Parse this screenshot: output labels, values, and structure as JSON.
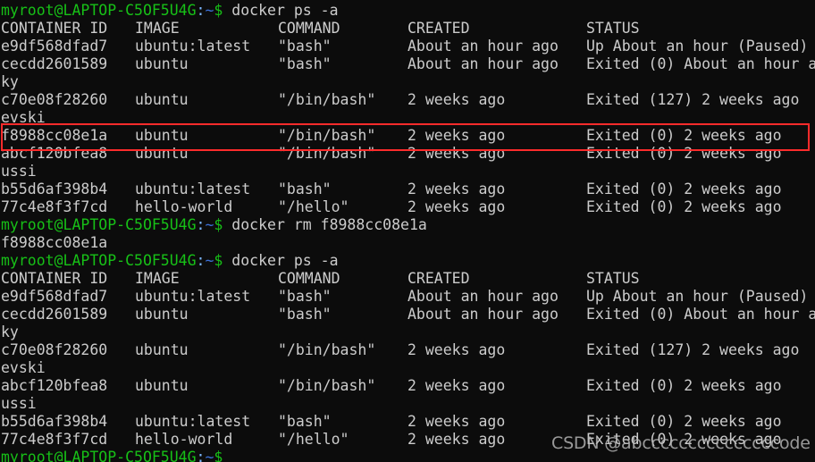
{
  "terminal": {
    "prompt": {
      "user_host": "myroot@LAPTOP-C5OF5U4G",
      "colon": ":",
      "tilde": "~",
      "dollar": "$",
      "colors": {
        "user_host": "#17c017",
        "colon": "#7cb7ff",
        "tilde": "#3b6fd6",
        "dollar": "#17c017",
        "text": "#cccccc",
        "background": "#0c0c0c",
        "highlight": "#ff2b2b"
      }
    },
    "commands": {
      "ps_a": "docker ps -a",
      "rm": "docker rm f8988cc08e1a"
    },
    "rm_output": "f8988cc08e1a",
    "table_headers": {
      "container_id": "CONTAINER ID",
      "image": "IMAGE",
      "command": "COMMAND",
      "created": "CREATED",
      "status": "STATUS"
    },
    "table_one": [
      {
        "id": "e9df568dfad7",
        "image": "ubuntu:latest",
        "command": "\"bash\"",
        "created": "About an hour ago",
        "status": "Up About an hour (Paused)",
        "wrap": ""
      },
      {
        "id": "cecdd2601589",
        "image": "ubuntu",
        "command": "\"bash\"",
        "created": "About an hour ago",
        "status": "Exited (0) About an hour a",
        "wrap": "ky"
      },
      {
        "id": "c70e08f28260",
        "image": "ubuntu",
        "command": "\"/bin/bash\"",
        "created": "2 weeks ago",
        "status": "Exited (127) 2 weeks ago",
        "wrap": "evski"
      },
      {
        "id": "f8988cc08e1a",
        "image": "ubuntu",
        "command": "\"/bin/bash\"",
        "created": "2 weeks ago",
        "status": "Exited (0) 2 weeks ago",
        "wrap": ""
      },
      {
        "id": "abcf120bfea8",
        "image": "ubuntu",
        "command": "\"/bin/bash\"",
        "created": "2 weeks ago",
        "status": "Exited (0) 2 weeks ago",
        "wrap": "ussi"
      },
      {
        "id": "b55d6af398b4",
        "image": "ubuntu:latest",
        "command": "\"bash\"",
        "created": "2 weeks ago",
        "status": "Exited (0) 2 weeks ago",
        "wrap": ""
      },
      {
        "id": "77c4e8f3f7cd",
        "image": "hello-world",
        "command": "\"/hello\"",
        "created": "2 weeks ago",
        "status": "Exited (0) 2 weeks ago",
        "wrap": ""
      }
    ],
    "table_two": [
      {
        "id": "e9df568dfad7",
        "image": "ubuntu:latest",
        "command": "\"bash\"",
        "created": "About an hour ago",
        "status": "Up About an hour (Paused)",
        "wrap": ""
      },
      {
        "id": "cecdd2601589",
        "image": "ubuntu",
        "command": "\"bash\"",
        "created": "About an hour ago",
        "status": "Exited (0) About an hour a",
        "wrap": "ky"
      },
      {
        "id": "c70e08f28260",
        "image": "ubuntu",
        "command": "\"/bin/bash\"",
        "created": "2 weeks ago",
        "status": "Exited (127) 2 weeks ago",
        "wrap": "evski"
      },
      {
        "id": "abcf120bfea8",
        "image": "ubuntu",
        "command": "\"/bin/bash\"",
        "created": "2 weeks ago",
        "status": "Exited (0) 2 weeks ago",
        "wrap": "ussi"
      },
      {
        "id": "b55d6af398b4",
        "image": "ubuntu:latest",
        "command": "\"bash\"",
        "created": "2 weeks ago",
        "status": "Exited (0) 2 weeks ago",
        "wrap": ""
      },
      {
        "id": "77c4e8f3f7cd",
        "image": "hello-world",
        "command": "\"/hello\"",
        "created": "2 weeks ago",
        "status": "Exited (0) 2 weeks ago",
        "wrap": ""
      }
    ],
    "highlighted_container_id": "f8988cc08e1a",
    "watermark": "CSDN @abcccccccccccccccode"
  }
}
